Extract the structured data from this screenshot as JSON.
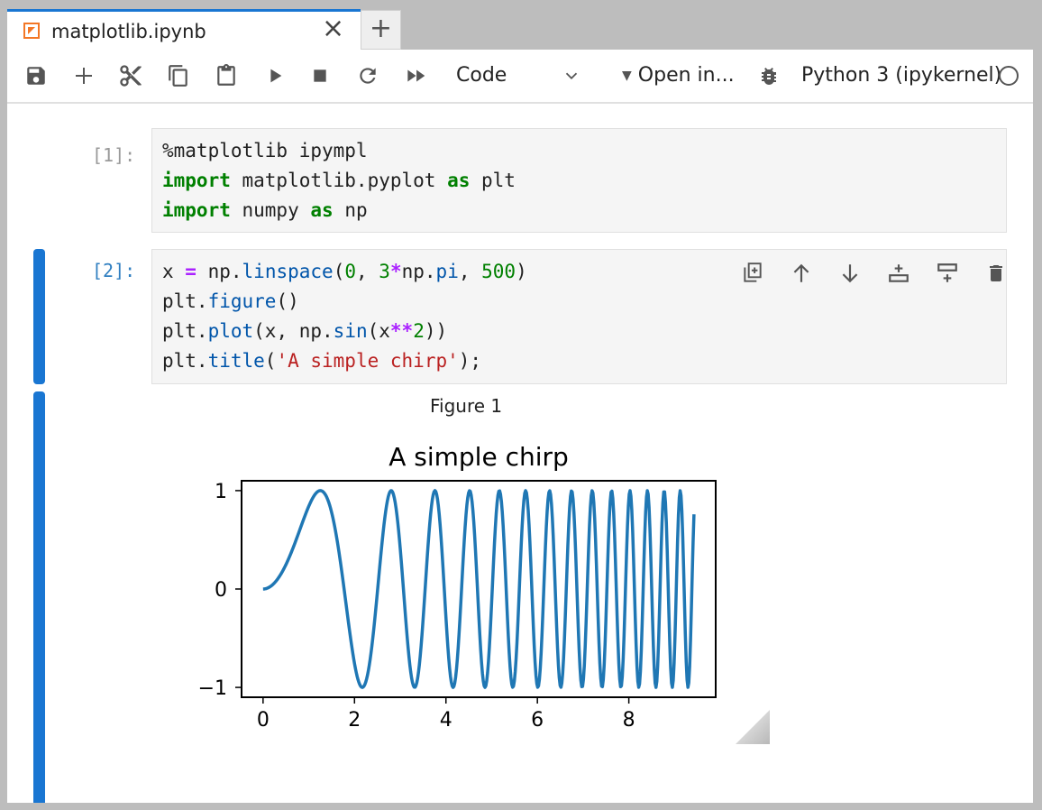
{
  "tab": {
    "title": "matplotlib.ipynb",
    "close_icon": "×",
    "add_icon": "+"
  },
  "toolbar": {
    "cell_type": "Code",
    "open_in": "Open in...",
    "kernel_name": "Python 3 (ipykernel)"
  },
  "cells": [
    {
      "prompt": "[1]:",
      "lines": [
        [
          {
            "t": "%matplotlib ipympl",
            "c": ""
          }
        ],
        [
          {
            "t": "import",
            "c": "kw"
          },
          {
            "t": " matplotlib.pyplot ",
            "c": ""
          },
          {
            "t": "as",
            "c": "kw"
          },
          {
            "t": " plt",
            "c": ""
          }
        ],
        [
          {
            "t": "import",
            "c": "kw"
          },
          {
            "t": " numpy ",
            "c": ""
          },
          {
            "t": "as",
            "c": "kw"
          },
          {
            "t": " np",
            "c": ""
          }
        ]
      ]
    },
    {
      "prompt": "[2]:",
      "lines": [
        [
          {
            "t": "x ",
            "c": ""
          },
          {
            "t": "=",
            "c": "op"
          },
          {
            "t": " np.",
            "c": ""
          },
          {
            "t": "linspace",
            "c": "fn"
          },
          {
            "t": "(",
            "c": ""
          },
          {
            "t": "0",
            "c": "num"
          },
          {
            "t": ", ",
            "c": ""
          },
          {
            "t": "3",
            "c": "num"
          },
          {
            "t": "*",
            "c": "op"
          },
          {
            "t": "np.",
            "c": ""
          },
          {
            "t": "pi",
            "c": "fn"
          },
          {
            "t": ", ",
            "c": ""
          },
          {
            "t": "500",
            "c": "num"
          },
          {
            "t": ")",
            "c": ""
          }
        ],
        [
          {
            "t": "plt.",
            "c": ""
          },
          {
            "t": "figure",
            "c": "fn"
          },
          {
            "t": "()",
            "c": ""
          }
        ],
        [
          {
            "t": "plt.",
            "c": ""
          },
          {
            "t": "plot",
            "c": "fn"
          },
          {
            "t": "(x, np.",
            "c": ""
          },
          {
            "t": "sin",
            "c": "fn"
          },
          {
            "t": "(x",
            "c": ""
          },
          {
            "t": "**",
            "c": "op"
          },
          {
            "t": "2",
            "c": "num"
          },
          {
            "t": "))",
            "c": ""
          }
        ],
        [
          {
            "t": "plt.",
            "c": ""
          },
          {
            "t": "title",
            "c": "fn"
          },
          {
            "t": "(",
            "c": ""
          },
          {
            "t": "'A simple chirp'",
            "c": "str"
          },
          {
            "t": ");",
            "c": ""
          }
        ]
      ]
    }
  ],
  "output": {
    "figure_label": "Figure 1"
  },
  "chart_data": {
    "type": "line",
    "title": "A simple chirp",
    "xlabel": "",
    "ylabel": "",
    "x_range": [
      0,
      9.42477796
    ],
    "num_points": 500,
    "function": "y = sin(x^2)",
    "xlim": [
      -0.47,
      9.9
    ],
    "ylim": [
      -1.1,
      1.1
    ],
    "xticks": [
      0,
      2,
      4,
      6,
      8
    ],
    "xtick_labels": [
      "0",
      "2",
      "4",
      "6",
      "8"
    ],
    "yticks": [
      -1,
      0,
      1
    ],
    "ytick_labels": [
      "−1",
      "0",
      "1"
    ],
    "grid": false,
    "series": [
      {
        "name": "sin(x**2)",
        "color": "#1f77b4"
      }
    ]
  }
}
